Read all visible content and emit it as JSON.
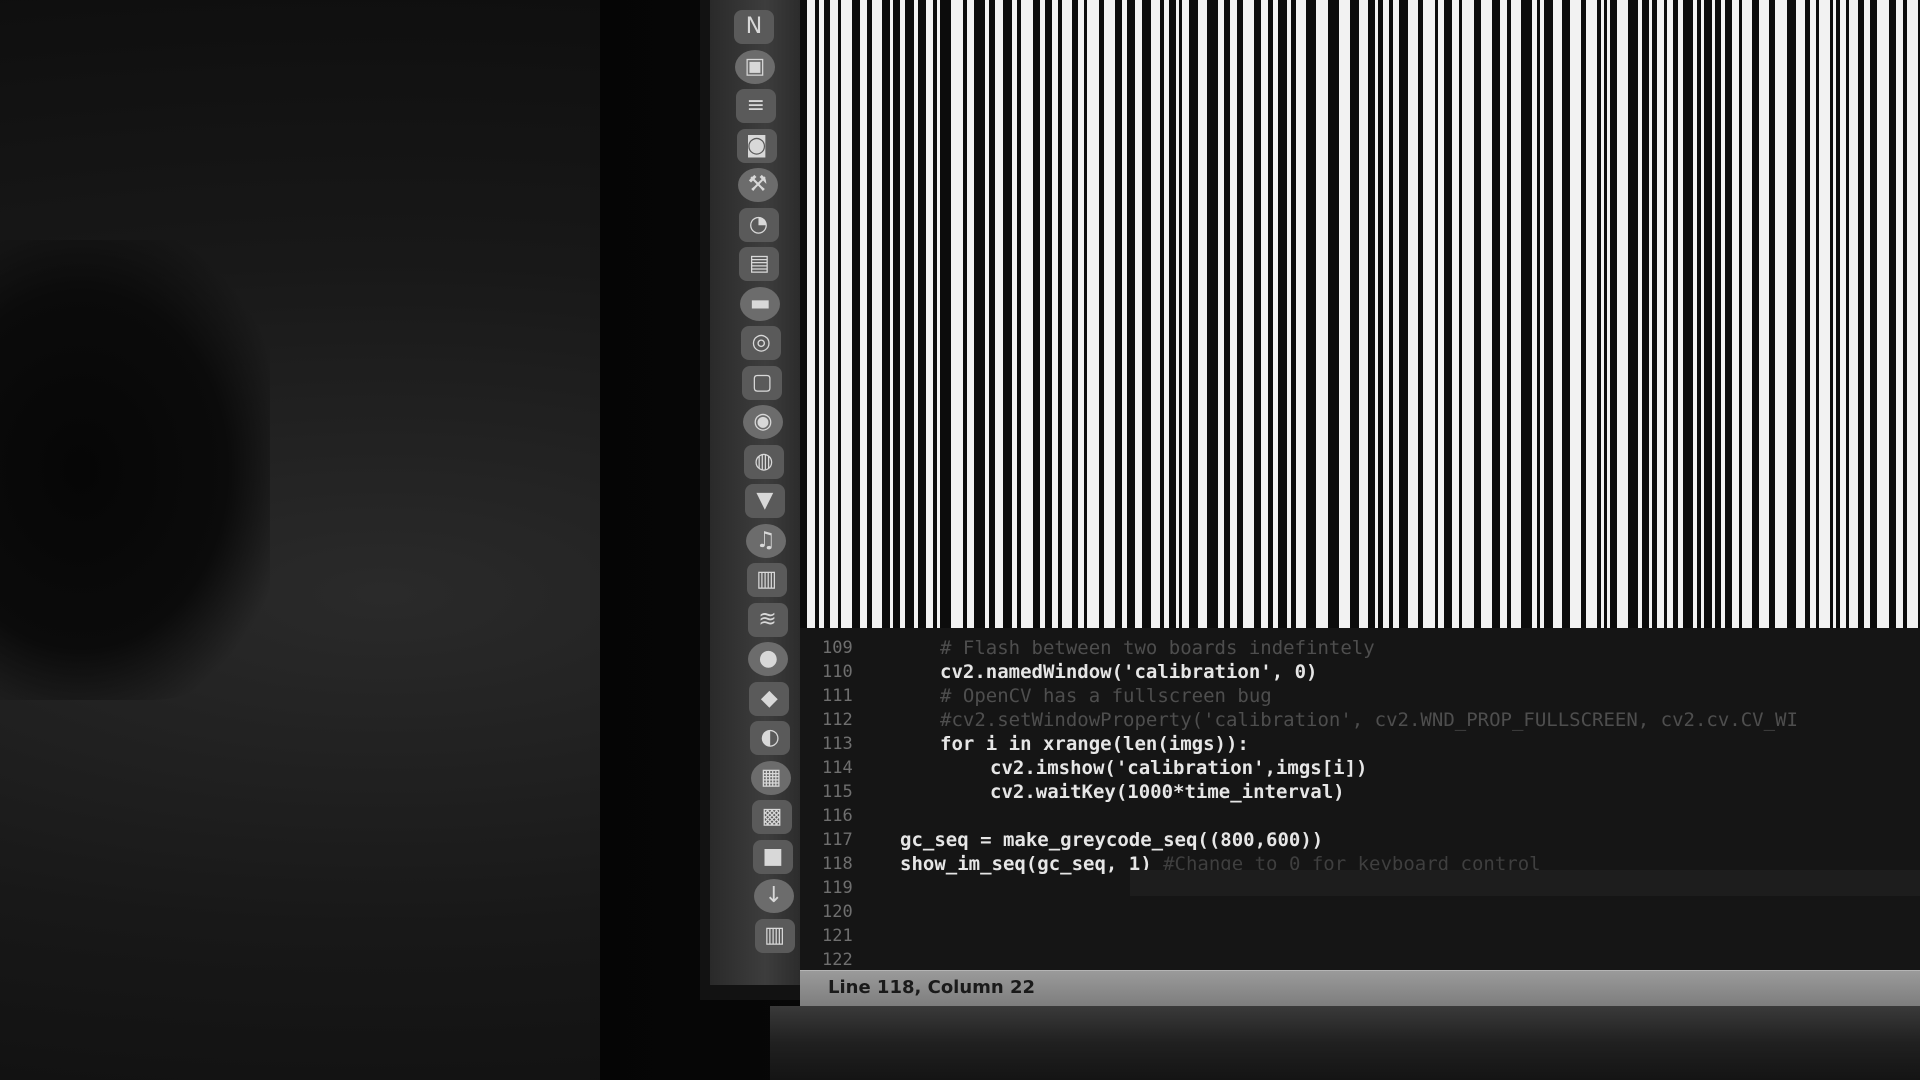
{
  "dock": {
    "items": [
      {
        "name": "nightly-app-icon",
        "glyph": "N"
      },
      {
        "name": "finder-icon",
        "glyph": "▣"
      },
      {
        "name": "lines-app-icon",
        "glyph": "≡"
      },
      {
        "name": "photo-app-icon",
        "glyph": "◙"
      },
      {
        "name": "tools-app-icon",
        "glyph": "⚒"
      },
      {
        "name": "chat-bubbles-icon",
        "glyph": "◔"
      },
      {
        "name": "notes-icon",
        "glyph": "▤"
      },
      {
        "name": "terminal-icon",
        "glyph": "▬"
      },
      {
        "name": "compass-icon",
        "glyph": "◎"
      },
      {
        "name": "preview-icon",
        "glyph": "▢"
      },
      {
        "name": "camera-icon",
        "glyph": "◉"
      },
      {
        "name": "chrome-icon",
        "glyph": "◍"
      },
      {
        "name": "shirt-app-icon",
        "glyph": "▼"
      },
      {
        "name": "music-icon",
        "glyph": "♫"
      },
      {
        "name": "books-icon",
        "glyph": "▥"
      },
      {
        "name": "spotify-icon",
        "glyph": "≋"
      },
      {
        "name": "globe-icon",
        "glyph": "●"
      },
      {
        "name": "sketch-icon",
        "glyph": "◆"
      },
      {
        "name": "github-icon",
        "glyph": "◐"
      },
      {
        "name": "window-app-icon",
        "glyph": "▦"
      },
      {
        "name": "calendar-app-icon",
        "glyph": "▩"
      },
      {
        "name": "dark-app-icon",
        "glyph": "■"
      },
      {
        "name": "downloads-icon",
        "glyph": "↓"
      },
      {
        "name": "trash-icon",
        "glyph": "▥"
      }
    ]
  },
  "editor": {
    "lines": [
      {
        "num": "109",
        "indent": 1,
        "style": "comment",
        "text": "# Flash between two boards indefintely",
        "trail": ""
      },
      {
        "num": "110",
        "indent": 1,
        "style": "code",
        "text": "cv2.namedWindow('calibration', 0)",
        "trail": ""
      },
      {
        "num": "111",
        "indent": 1,
        "style": "comment",
        "text": "# OpenCV has a fullscreen bug",
        "trail": ""
      },
      {
        "num": "112",
        "indent": 1,
        "style": "comment",
        "text": "#cv2.setWindowProperty('calibration', cv2.WND_PROP_FULLSCREEN, cv2.cv.CV_WI",
        "trail": ""
      },
      {
        "num": "113",
        "indent": 1,
        "style": "code",
        "text": "for i in xrange(len(imgs)):",
        "trail": ""
      },
      {
        "num": "114",
        "indent": 2,
        "style": "code",
        "text": "cv2.imshow('calibration',imgs[i])",
        "trail": ""
      },
      {
        "num": "115",
        "indent": 2,
        "style": "code",
        "text": "cv2.waitKey(1000*time_interval)",
        "trail": ""
      },
      {
        "num": "116",
        "indent": 0,
        "style": "code",
        "text": "",
        "trail": ""
      },
      {
        "num": "117",
        "indent": 0,
        "style": "code",
        "text": "gc_seq = make_greycode_seq((800,600))",
        "trail": ""
      },
      {
        "num": "118",
        "indent": 0,
        "style": "code",
        "text": "show_im_seq(gc_seq, 1) ",
        "trail": "#Change to 0 for keyboard control"
      },
      {
        "num": "119",
        "indent": 0,
        "style": "code",
        "text": "",
        "trail": ""
      },
      {
        "num": "120",
        "indent": 0,
        "style": "code",
        "text": "",
        "trail": ""
      },
      {
        "num": "121",
        "indent": 0,
        "style": "code",
        "text": "",
        "trail": ""
      },
      {
        "num": "122",
        "indent": 0,
        "style": "code",
        "text": "",
        "trail": ""
      }
    ]
  },
  "status_bar": {
    "text": "Line 118, Column 22"
  },
  "colors": {
    "pattern_white": "#f2f2f2",
    "pattern_black": "#0c0c0c",
    "editor_bg": "#151515",
    "status_bg": "#8c8c8c"
  }
}
